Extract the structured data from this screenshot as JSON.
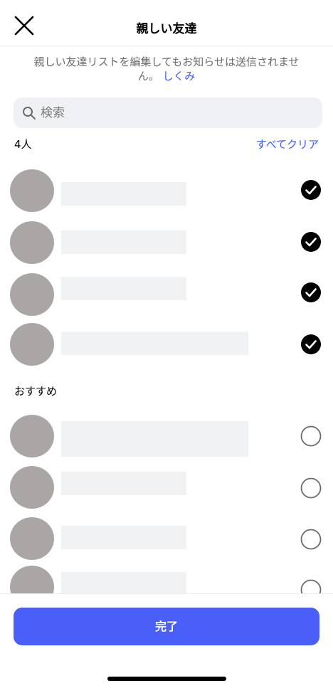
{
  "header": {
    "title": "親しい友達",
    "close_icon": "close-icon"
  },
  "notice": {
    "text": "親しい友達リストを編集してもお知らせは送信されません。",
    "link_label": "しくみ"
  },
  "search": {
    "placeholder": "検索",
    "value": ""
  },
  "selected": {
    "count_label": "4人",
    "clear_label": "すべてクリア",
    "items": [
      {
        "checked": true
      },
      {
        "checked": true
      },
      {
        "checked": true
      },
      {
        "checked": true
      }
    ]
  },
  "suggested": {
    "label": "おすすめ",
    "items": [
      {
        "checked": false
      },
      {
        "checked": false
      },
      {
        "checked": false
      },
      {
        "checked": false
      }
    ]
  },
  "footer": {
    "done_label": "完了"
  },
  "colors": {
    "accent": "#4a5ff7",
    "link": "#3d5afe",
    "avatar": "#aaa6a6",
    "placeholder_bar": "#f1f2f4"
  }
}
